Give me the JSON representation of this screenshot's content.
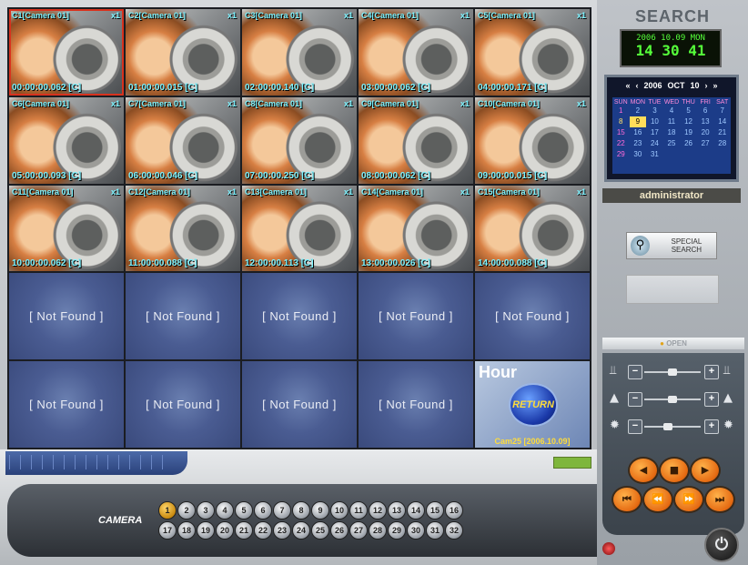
{
  "side": {
    "title": "SEARCH",
    "date_lcd": "2006 10.09 MON",
    "time_lcd": "14 30 41",
    "calendar": {
      "nav_prev2": "«",
      "nav_prev": "‹",
      "year": "2006",
      "month": "OCT",
      "day": "10",
      "nav_next": "›",
      "nav_next2": "»",
      "weekdays": [
        "SUN",
        "MON",
        "TUE",
        "WED",
        "THU",
        "FRI",
        "SAT"
      ],
      "days": [
        "1",
        "2",
        "3",
        "4",
        "5",
        "6",
        "7",
        "8",
        "9",
        "10",
        "11",
        "12",
        "13",
        "14",
        "15",
        "16",
        "17",
        "18",
        "19",
        "20",
        "21",
        "22",
        "23",
        "24",
        "25",
        "26",
        "27",
        "28",
        "29",
        "30",
        "31"
      ],
      "selected_day": "9"
    },
    "user": "administrator",
    "special_search_label": "SPECIAL SEARCH",
    "open_label": "OPEN",
    "power_icon": "power-icon"
  },
  "cameras": [
    {
      "title": "C1[Camera 01]",
      "time": "00:00:00.062 [C]"
    },
    {
      "title": "C2[Camera 01]",
      "time": "01:00:00.015 [C]"
    },
    {
      "title": "C3[Camera 01]",
      "time": "02:00:00.140 [C]"
    },
    {
      "title": "C4[Camera 01]",
      "time": "03:00:00.062 [C]"
    },
    {
      "title": "C5[Camera 01]",
      "time": "04:00:00.171 [C]"
    },
    {
      "title": "C6[Camera 01]",
      "time": "05:00:00.093 [C]"
    },
    {
      "title": "C7[Camera 01]",
      "time": "06:00:00.046 [C]"
    },
    {
      "title": "C8[Camera 01]",
      "time": "07:00:00.250 [C]"
    },
    {
      "title": "C9[Camera 01]",
      "time": "08:00:00.062 [C]"
    },
    {
      "title": "C10[Camera 01]",
      "time": "09:00:00.015 [C]"
    },
    {
      "title": "C11[Camera 01]",
      "time": "10:00:00.062 [C]"
    },
    {
      "title": "C12[Camera 01]",
      "time": "11:00:00.088 [C]"
    },
    {
      "title": "C13[Camera 01]",
      "time": "12:00:00.113 [C]"
    },
    {
      "title": "C14[Camera 01]",
      "time": "13:00:00.026 [C]"
    },
    {
      "title": "C15[Camera 01]",
      "time": "14:00:00.088 [C]"
    }
  ],
  "cam_mark": "x1",
  "not_found_label": "[ Not Found ]",
  "hour_tile": {
    "label": "Hour",
    "button": "RETURN",
    "caption": "Cam25 [2006.10.09]"
  },
  "camera_bar": {
    "label": "CAMERA",
    "buttons": [
      "1",
      "2",
      "3",
      "4",
      "5",
      "6",
      "7",
      "8",
      "9",
      "10",
      "11",
      "12",
      "13",
      "14",
      "15",
      "16",
      "17",
      "18",
      "19",
      "20",
      "21",
      "22",
      "23",
      "24",
      "25",
      "26",
      "27",
      "28",
      "29",
      "30",
      "31",
      "32"
    ],
    "selected": "1"
  },
  "playback": {
    "row1": [
      "◀",
      "■",
      "▶"
    ],
    "row2": [
      "⏮",
      "⏪",
      "⏩",
      "⏭"
    ]
  },
  "sliders": [
    {
      "left_icon": "run-icon",
      "right_icon": "run-icon",
      "level": 0.5
    },
    {
      "left_icon": "mountain-icon",
      "right_icon": "mountain-icon",
      "level": 0.5
    },
    {
      "left_icon": "sun-icon",
      "right_icon": "sun-icon",
      "level": 0.4
    }
  ],
  "colors": {
    "accent": "#e56a12",
    "lcd": "#55ff3a",
    "cam_text": "#7cf3ff",
    "not_found": "#4a5c92"
  }
}
